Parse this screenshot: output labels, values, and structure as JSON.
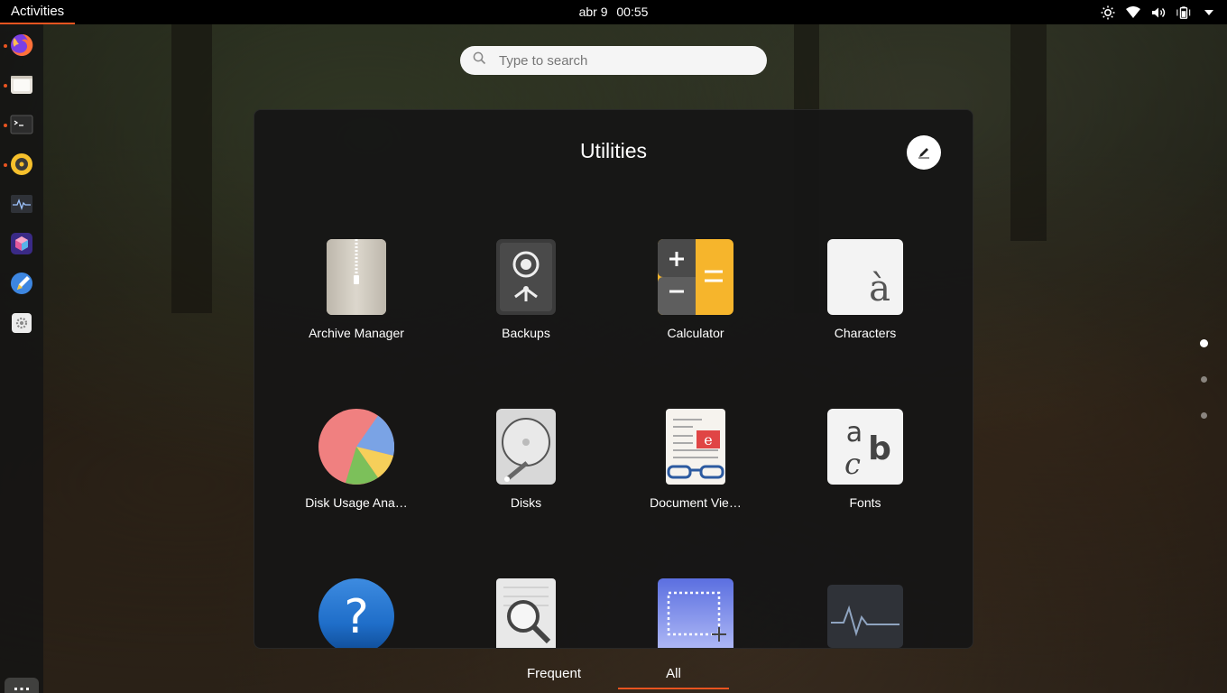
{
  "topbar": {
    "activities": "Activities",
    "date": "abr 9",
    "time": "00:55",
    "tray_icons": [
      "brightness-icon",
      "wifi-icon",
      "volume-icon",
      "battery-icon",
      "chevron-down-icon"
    ]
  },
  "dock": {
    "items": [
      {
        "name": "firefox",
        "running": true
      },
      {
        "name": "files",
        "running": true
      },
      {
        "name": "terminal",
        "running": true
      },
      {
        "name": "rhythmbox",
        "running": true
      },
      {
        "name": "system-monitor",
        "running": false
      },
      {
        "name": "app-center",
        "running": false
      },
      {
        "name": "text-editor",
        "running": false
      },
      {
        "name": "settings",
        "running": false
      }
    ]
  },
  "search": {
    "placeholder": "Type to search"
  },
  "folder": {
    "title": "Utilities",
    "apps": [
      {
        "label": "Archive Manager"
      },
      {
        "label": "Backups"
      },
      {
        "label": "Calculator"
      },
      {
        "label": "Characters"
      },
      {
        "label": "Disk Usage Ana…"
      },
      {
        "label": "Disks"
      },
      {
        "label": "Document Vie…"
      },
      {
        "label": "Fonts"
      },
      {
        "label": "Help"
      },
      {
        "label": "Log Viewer"
      },
      {
        "label": "Screenshot"
      },
      {
        "label": "System Monitor"
      }
    ]
  },
  "pages": {
    "count": 3,
    "active": 1
  },
  "tabs": {
    "frequent": "Frequent",
    "all": "All",
    "active": "all"
  },
  "colors": {
    "accent": "#e95420"
  }
}
